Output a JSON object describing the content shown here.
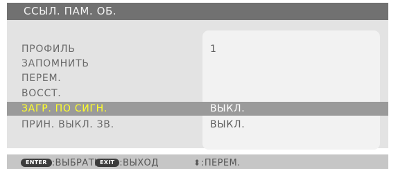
{
  "window": {
    "title": "ССЫЛ. ПАМ. ОБ."
  },
  "menu": {
    "rows": [
      {
        "label": "ПРОФИЛЬ",
        "value": "1"
      },
      {
        "label": "ЗАПОМНИТЬ",
        "value": ""
      },
      {
        "label": "ПЕРЕМ.",
        "value": ""
      },
      {
        "label": "ВОССТ.",
        "value": ""
      },
      {
        "label": "ЗАГР. ПО СИГН.",
        "value": "ВЫКЛ.",
        "selected": true
      },
      {
        "label": "ПРИН. ВЫКЛ. ЗВ.",
        "value": "ВЫКЛ."
      }
    ]
  },
  "footer": {
    "enter_key": "ENTER",
    "enter_text": ":ВЫБРАТЬ",
    "exit_key": "EXIT",
    "exit_text": ":ВЫХОД",
    "move_icon": "up-down-arrows-icon",
    "move_text": ":ПЕРЕМ."
  },
  "colors": {
    "title_bar": "#717171",
    "panel": "#e3e3e3",
    "selected_row": "#9a9a9a",
    "selected_label": "#ffff2a",
    "footer": "#c6c6c6"
  }
}
